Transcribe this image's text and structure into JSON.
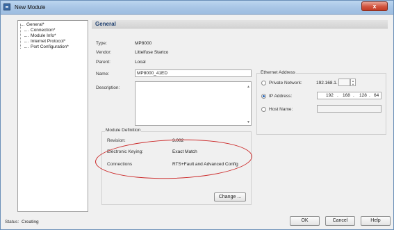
{
  "window": {
    "title": "New Module",
    "close_symbol": "x"
  },
  "tree": {
    "items": [
      {
        "label": "General*",
        "level": 0
      },
      {
        "label": "Connection*",
        "level": 1
      },
      {
        "label": "Module Info*",
        "level": 1
      },
      {
        "label": "Internet Protocol*",
        "level": 1
      },
      {
        "label": "Port Configuration*",
        "level": 1
      }
    ]
  },
  "general": {
    "header": "General",
    "type_label": "Type:",
    "type_value": "MP8000",
    "vendor_label": "Vendor:",
    "vendor_value": "Littelfuse Startco",
    "parent_label": "Parent:",
    "parent_value": "Local",
    "name_label": "Name:",
    "name_value": "MP8000_41ED",
    "description_label": "Description:",
    "description_value": ""
  },
  "ethernet": {
    "title": "Ethernet Address",
    "private_network_label": "Private Network:",
    "private_prefix": "192.168.1.",
    "private_octet": "",
    "ip_address_label": "IP Address:",
    "ip_octets": [
      "192",
      "168",
      "128",
      "64"
    ],
    "host_name_label": "Host Name:",
    "host_name_value": "",
    "selected": "ip_address"
  },
  "module_definition": {
    "title": "Module Definition",
    "revision_label": "Revision:",
    "revision_value": "3.002",
    "keying_label": "Electronic Keying:",
    "keying_value": "Exact Match",
    "connections_label": "Connections",
    "connections_value": "RTS+Fault and Advanced Config",
    "change_button": "Change ..."
  },
  "status": {
    "label": "Status:",
    "value": "Creating"
  },
  "buttons": {
    "ok": "OK",
    "cancel": "Cancel",
    "help": "Help"
  },
  "colors": {
    "annotation_ellipse": "#cc2a2a",
    "titlebar": "#a9c6e6",
    "close_button": "#d1533d",
    "header_title": "#1e3f6e"
  }
}
